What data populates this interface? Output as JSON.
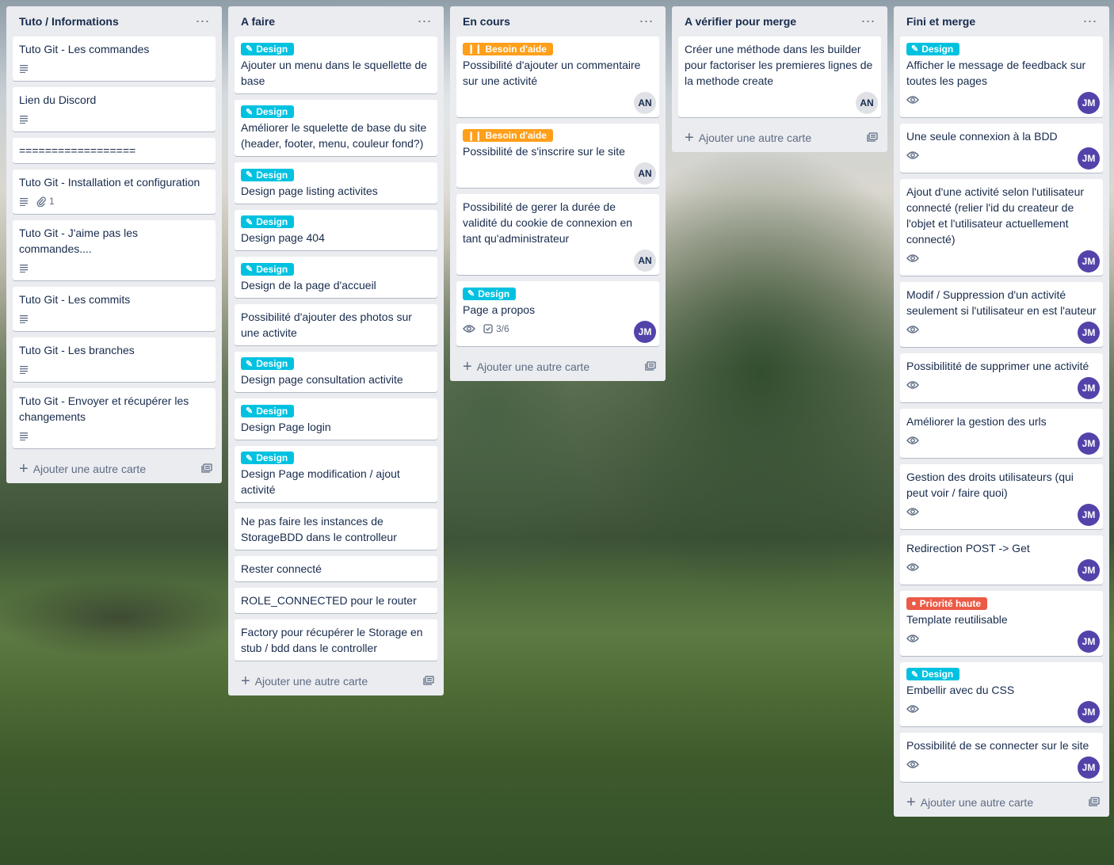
{
  "menu_icon": "more-dots-icon",
  "add_card_label": "Ajouter une autre carte",
  "label_colors": {
    "design": "#00c2e0",
    "help": "#ff9f1a",
    "prio": "#eb5a46"
  },
  "lists": [
    {
      "title": "Tuto / Informations",
      "cards": [
        {
          "title": "Tuto Git - Les commandes",
          "description": true
        },
        {
          "title": "Lien du Discord",
          "description": true
        },
        {
          "title": "=================="
        },
        {
          "title": "Tuto Git - Installation et configuration",
          "description": true,
          "attachments": "1"
        },
        {
          "title": "Tuto Git - J'aime pas les commandes....",
          "description": true
        },
        {
          "title": "Tuto Git - Les commits",
          "description": true
        },
        {
          "title": "Tuto Git - Les branches",
          "description": true
        },
        {
          "title": "Tuto Git - Envoyer et récupérer les changements",
          "description": true
        }
      ]
    },
    {
      "title": "A faire",
      "cards": [
        {
          "label": "Design",
          "title": "Ajouter un menu dans le squellette de base"
        },
        {
          "label": "Design",
          "title": "Améliorer le squelette de base du site (header, footer, menu, couleur fond?)"
        },
        {
          "label": "Design",
          "title": "Design page listing activites"
        },
        {
          "label": "Design",
          "title": "Design page 404"
        },
        {
          "label": "Design",
          "title": "Design de la page d'accueil"
        },
        {
          "title": "Possibilité d'ajouter des photos sur une activite"
        },
        {
          "label": "Design",
          "title": "Design page consultation activite"
        },
        {
          "label": "Design",
          "title": "Design Page login"
        },
        {
          "label": "Design",
          "title": "Design Page modification / ajout activité"
        },
        {
          "title": "Ne pas faire les instances de StorageBDD dans le controlleur"
        },
        {
          "title": "Rester connecté"
        },
        {
          "title": "ROLE_CONNECTED pour le router"
        },
        {
          "title": "Factory pour récupérer le Storage en stub / bdd dans le controller"
        }
      ]
    },
    {
      "title": "En cours",
      "cards": [
        {
          "label": "Besoin d'aide",
          "title": "Possibilité d'ajouter un commentaire sur une activité",
          "avatar": "AN"
        },
        {
          "label": "Besoin d'aide",
          "title": "Possibilité de s'inscrire sur le site",
          "avatar": "AN"
        },
        {
          "title": "Possibilité de gerer la durée de validité du cookie de connexion en tant qu'administrateur",
          "avatar": "AN"
        },
        {
          "label": "Design",
          "title": "Page a propos",
          "watch": true,
          "checklist": "3/6",
          "avatar": "JM"
        }
      ]
    },
    {
      "title": "A vérifier pour merge",
      "cards": [
        {
          "title": "Créer une méthode dans les builder pour factoriser les premieres lignes de la methode create",
          "avatar": "AN"
        }
      ]
    },
    {
      "title": "Fini et merge",
      "cards": [
        {
          "label": "Design",
          "title": "Afficher le message de feedback sur toutes les pages",
          "watch": true,
          "avatar": "JM"
        },
        {
          "title": "Une seule connexion à la BDD",
          "watch": true,
          "avatar": "JM"
        },
        {
          "title": "Ajout d'une activité selon l'utilisateur connecté (relier l'id du createur de l'objet et l'utilisateur actuellement connecté)",
          "watch": true,
          "avatar": "JM"
        },
        {
          "title": "Modif / Suppression d'un activité seulement si l'utilisateur en est l'auteur",
          "watch": true,
          "avatar": "JM"
        },
        {
          "title": "Possibilitité de supprimer une activité",
          "watch": true,
          "avatar": "JM"
        },
        {
          "title": "Améliorer la gestion des urls",
          "watch": true,
          "avatar": "JM"
        },
        {
          "title": "Gestion des droits utilisateurs (qui peut voir / faire quoi)",
          "watch": true,
          "avatar": "JM"
        },
        {
          "title": "Redirection POST -> Get",
          "watch": true,
          "avatar": "JM"
        },
        {
          "label": "Priorité haute",
          "title": "Template reutilisable",
          "watch": true,
          "avatar": "JM"
        },
        {
          "label": "Design",
          "title": "Embellir avec du CSS",
          "watch": true,
          "avatar": "JM"
        },
        {
          "title": "Possibilité de se connecter sur le site",
          "watch": true,
          "avatar": "JM"
        }
      ]
    }
  ]
}
